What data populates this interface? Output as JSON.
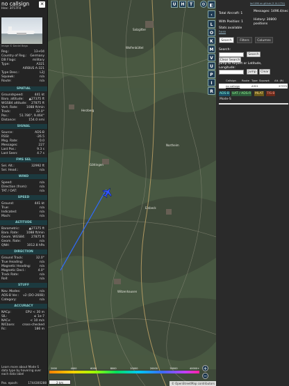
{
  "aircraft": {
    "callsign": "no callsign",
    "hex": "Hex: 3F57F0",
    "photo_credit": "Image © Daniel Bega"
  },
  "details": {
    "rows": [
      {
        "k": "Reg.:",
        "v": "13+04"
      },
      {
        "k": "Country of Reg.:",
        "v": "Germany"
      },
      {
        "k": "DB Flags:",
        "v": "military"
      },
      {
        "k": "Type:",
        "v": "A321"
      },
      {
        "k": "",
        "v": "AIRBUS A-321"
      },
      {
        "k": "Type Desc.:",
        "v": "L2J"
      },
      {
        "k": "Squawk:",
        "v": "n/a"
      },
      {
        "k": "Route:",
        "v": "n/a"
      }
    ]
  },
  "sections": {
    "spatial": "SPATIAL",
    "signal": "SIGNAL",
    "fms_sel": "FMS SEL",
    "wind": "WIND",
    "speed": "SPEED",
    "altitude": "ALTITUDE",
    "direction": "DIRECTION",
    "stuff": "STUFF",
    "accuracy": "ACCURACY"
  },
  "spatial": [
    {
      "k": "Groundspeed:",
      "v": "441 kt"
    },
    {
      "k": "Baro. altitude:",
      "v": "▲27375 ft"
    },
    {
      "k": "WGS84 altitude:",
      "v": "27875 ft"
    },
    {
      "k": "Vert. Rate:",
      "v": "1088 ft/min"
    },
    {
      "k": "Track:",
      "v": "32.0°"
    },
    {
      "k": "Pos.:",
      "v": "51.786°, 9.464°"
    },
    {
      "k": "Distance:",
      "v": "154.0 nmi"
    }
  ],
  "signal": [
    {
      "k": "Source:",
      "v": "ADS-B"
    },
    {
      "k": "RSSI:",
      "v": "-26.5"
    },
    {
      "k": "Msg. Rate:",
      "v": "0.0"
    },
    {
      "k": "Messages:",
      "v": "227"
    },
    {
      "k": "Last Pos.:",
      "v": "9.3 s"
    },
    {
      "k": "Last Seen:",
      "v": "4.7 s"
    }
  ],
  "fms": [
    {
      "k": "Sel. Alt.:",
      "v": "32992 ft"
    },
    {
      "k": "Sel. Head.:",
      "v": "n/a"
    }
  ],
  "wind": [
    {
      "k": "Speed:",
      "v": "n/a"
    },
    {
      "k": "Direction (from):",
      "v": "n/a"
    },
    {
      "k": "TAT / OAT:",
      "v": "n/a"
    }
  ],
  "speed": [
    {
      "k": "Ground:",
      "v": "441 kt"
    },
    {
      "k": "True:",
      "v": "n/a"
    },
    {
      "k": "Indicated:",
      "v": "n/a"
    },
    {
      "k": "Mach:",
      "v": "n/a"
    }
  ],
  "altitude": [
    {
      "k": "Barometric:",
      "v": "▲27375 ft"
    },
    {
      "k": "Baro. Rate:",
      "v": "1088 ft/min"
    },
    {
      "k": "Geom. WGS84:",
      "v": "27875 ft"
    },
    {
      "k": "Geom. Rate:",
      "v": "n/a"
    },
    {
      "k": "QNH:",
      "v": "1012.8 hPa"
    }
  ],
  "direction": [
    {
      "k": "Ground Track:",
      "v": "32.0°"
    },
    {
      "k": "True Heading:",
      "v": "n/a"
    },
    {
      "k": "Magnetic Heading:",
      "v": "n/a"
    },
    {
      "k": "Magnetic Decl.:",
      "v": "4.0°"
    },
    {
      "k": "Track Rate:",
      "v": "n/a"
    },
    {
      "k": "Roll:",
      "v": "n/a"
    }
  ],
  "stuff": [
    {
      "k": "Nav. Modes:",
      "v": "n/a"
    },
    {
      "k": "ADS-B Ver.:",
      "v": "v2 (DO-260B)"
    },
    {
      "k": "Category:",
      "v": "n/a"
    }
  ],
  "accuracy": [
    {
      "k": "NACp:",
      "v": "EPU < 30 m"
    },
    {
      "k": "SIL:",
      "v": "≤ 1e-7"
    },
    {
      "k": "NACv:",
      "v": "< 10 m/s"
    },
    {
      "k": "NICbaro:",
      "v": "cross-checked"
    },
    {
      "k": "Rc:",
      "v": "186 m"
    }
  ],
  "note": "Learn more about Mode S data type by hovering over each data label",
  "epoch": {
    "k": "Pos. epoch:",
    "v": "1744300288"
  },
  "map": {
    "top_buttons": [
      "U",
      "H",
      "T"
    ],
    "side_buttons": [
      "L",
      "O",
      "K",
      "M",
      "V",
      "U",
      "P",
      "I",
      "R"
    ],
    "scale": "2 km",
    "attribution": "© OpenStreetMap contributors",
    "colorbar_labels": [
      "2000",
      "4000",
      "6000",
      "8000",
      "10000",
      "20000",
      "30000",
      "40000+"
    ],
    "place_labels": [
      "Salzgitter",
      "Wolfenbüttel",
      "Herzberg",
      "Göttingen",
      "Northeim",
      "Einbeck",
      "Witzenhausen"
    ]
  },
  "stats": {
    "link": "tar1090 on github (3.14.1751)",
    "total_aircraft": "Total Aircraft: 1",
    "messages": "Messages: 1496.4/sec",
    "with_position": "With Position: 1",
    "history": "History: 30800 positions",
    "stats_available": "Stats available",
    "stats_here": "here"
  },
  "tabs": [
    "Search",
    "Filters",
    "Columns"
  ],
  "search": {
    "label": "Search:",
    "button": "Search",
    "clear": "Clear Search",
    "jump_label": "Jump to Airport or Latitude, Longitude:",
    "jump_button": "Jump",
    "jump_clear": "Clear"
  },
  "table": {
    "headers": [
      "",
      "Callsign",
      "Route",
      "Type",
      "Squawk",
      "Alt. (ft)"
    ],
    "rows": [
      [
        "",
        "no callsign",
        "",
        "A321",
        "",
        "27375"
      ]
    ]
  },
  "sources": [
    "ADS-B",
    "UAT / ADS-R",
    "MLAT",
    "TIS-B",
    "Mode-S"
  ],
  "colors": {
    "accent": "#1c3a3f",
    "map_bg": "#3f4a3a",
    "track": "#2f6bff",
    "aircraft": "#3355ff"
  }
}
